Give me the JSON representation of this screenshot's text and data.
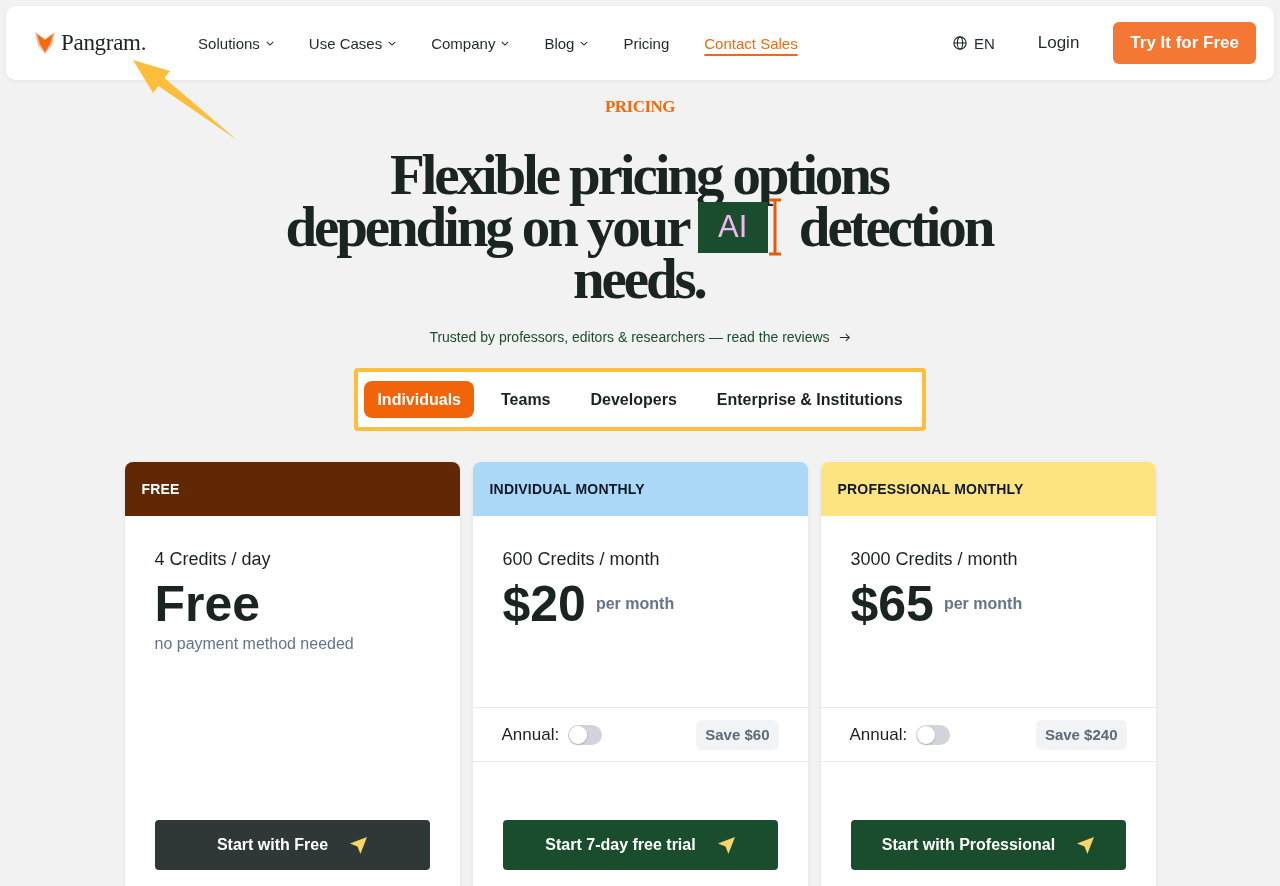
{
  "nav": {
    "brand": "Pangram.",
    "items": [
      {
        "label": "Solutions",
        "has_menu": true,
        "accent": false
      },
      {
        "label": "Use Cases",
        "has_menu": true,
        "accent": false
      },
      {
        "label": "Company",
        "has_menu": true,
        "accent": false
      },
      {
        "label": "Blog",
        "has_menu": true,
        "accent": false
      },
      {
        "label": "Pricing",
        "has_menu": false,
        "accent": false
      },
      {
        "label": "Contact Sales",
        "has_menu": false,
        "accent": true
      }
    ],
    "language": "EN",
    "login": "Login",
    "cta": "Try It for Free"
  },
  "eyebrow": "PRICING",
  "headline": {
    "lines": [
      {
        "segments": [
          {
            "kind": "text",
            "text": "Flexible pricing options"
          }
        ]
      },
      {
        "segments": [
          {
            "kind": "text",
            "text": "depending on your"
          },
          {
            "kind": "typed",
            "text": "AI"
          },
          {
            "kind": "text",
            "text": "detection"
          }
        ]
      },
      {
        "segments": [
          {
            "kind": "text",
            "text": "needs."
          }
        ]
      }
    ]
  },
  "reviews_link": "Trusted by professors, editors & researchers — read the reviews",
  "tabs": [
    {
      "label": "Individuals",
      "selected": true
    },
    {
      "label": "Teams",
      "selected": false
    },
    {
      "label": "Developers",
      "selected": false
    },
    {
      "label": "Enterprise & Institutions",
      "selected": false
    }
  ],
  "plans": [
    {
      "kind": "free",
      "name": "FREE",
      "color": "#612805",
      "credits": "4 Credits / day",
      "price": "Free",
      "note": "no payment method needed",
      "button": "Start with Free"
    },
    {
      "kind": "paid",
      "name": "INDIVIDUAL MONTHLY",
      "color": "#acd8f7",
      "credits": "600 Credits / month",
      "price": "$20",
      "period": "per month",
      "annual": {
        "label": "Annual:",
        "on": false,
        "savings": "Save $60"
      },
      "button": "Start 7-day free trial"
    },
    {
      "kind": "paid",
      "name": "PROFESSIONAL MONTHLY",
      "color": "#fce581",
      "credits": "3000 Credits / month",
      "price": "$65",
      "period": "per month",
      "annual": {
        "label": "Annual:",
        "on": false,
        "savings": "Save $240"
      },
      "button": "Start with Professional"
    }
  ]
}
